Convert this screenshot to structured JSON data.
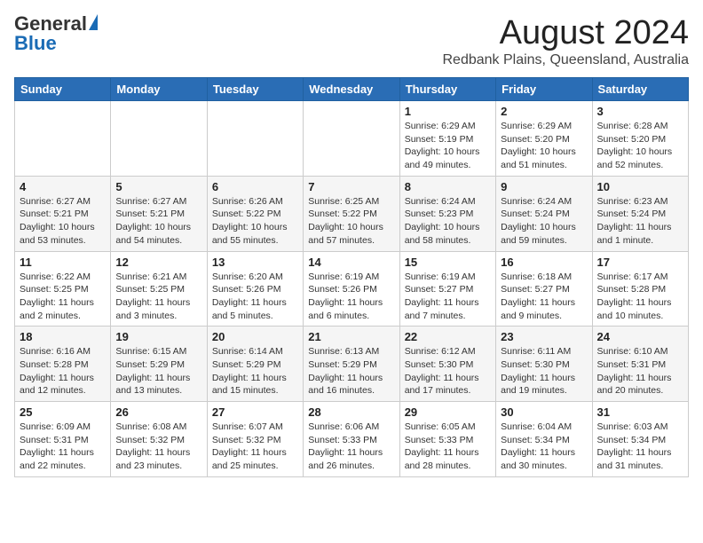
{
  "header": {
    "logo_general": "General",
    "logo_blue": "Blue",
    "month_title": "August 2024",
    "location": "Redbank Plains, Queensland, Australia"
  },
  "weekdays": [
    "Sunday",
    "Monday",
    "Tuesday",
    "Wednesday",
    "Thursday",
    "Friday",
    "Saturday"
  ],
  "weeks": [
    [
      {
        "day": "",
        "info": ""
      },
      {
        "day": "",
        "info": ""
      },
      {
        "day": "",
        "info": ""
      },
      {
        "day": "",
        "info": ""
      },
      {
        "day": "1",
        "info": "Sunrise: 6:29 AM\nSunset: 5:19 PM\nDaylight: 10 hours\nand 49 minutes."
      },
      {
        "day": "2",
        "info": "Sunrise: 6:29 AM\nSunset: 5:20 PM\nDaylight: 10 hours\nand 51 minutes."
      },
      {
        "day": "3",
        "info": "Sunrise: 6:28 AM\nSunset: 5:20 PM\nDaylight: 10 hours\nand 52 minutes."
      }
    ],
    [
      {
        "day": "4",
        "info": "Sunrise: 6:27 AM\nSunset: 5:21 PM\nDaylight: 10 hours\nand 53 minutes."
      },
      {
        "day": "5",
        "info": "Sunrise: 6:27 AM\nSunset: 5:21 PM\nDaylight: 10 hours\nand 54 minutes."
      },
      {
        "day": "6",
        "info": "Sunrise: 6:26 AM\nSunset: 5:22 PM\nDaylight: 10 hours\nand 55 minutes."
      },
      {
        "day": "7",
        "info": "Sunrise: 6:25 AM\nSunset: 5:22 PM\nDaylight: 10 hours\nand 57 minutes."
      },
      {
        "day": "8",
        "info": "Sunrise: 6:24 AM\nSunset: 5:23 PM\nDaylight: 10 hours\nand 58 minutes."
      },
      {
        "day": "9",
        "info": "Sunrise: 6:24 AM\nSunset: 5:24 PM\nDaylight: 10 hours\nand 59 minutes."
      },
      {
        "day": "10",
        "info": "Sunrise: 6:23 AM\nSunset: 5:24 PM\nDaylight: 11 hours\nand 1 minute."
      }
    ],
    [
      {
        "day": "11",
        "info": "Sunrise: 6:22 AM\nSunset: 5:25 PM\nDaylight: 11 hours\nand 2 minutes."
      },
      {
        "day": "12",
        "info": "Sunrise: 6:21 AM\nSunset: 5:25 PM\nDaylight: 11 hours\nand 3 minutes."
      },
      {
        "day": "13",
        "info": "Sunrise: 6:20 AM\nSunset: 5:26 PM\nDaylight: 11 hours\nand 5 minutes."
      },
      {
        "day": "14",
        "info": "Sunrise: 6:19 AM\nSunset: 5:26 PM\nDaylight: 11 hours\nand 6 minutes."
      },
      {
        "day": "15",
        "info": "Sunrise: 6:19 AM\nSunset: 5:27 PM\nDaylight: 11 hours\nand 7 minutes."
      },
      {
        "day": "16",
        "info": "Sunrise: 6:18 AM\nSunset: 5:27 PM\nDaylight: 11 hours\nand 9 minutes."
      },
      {
        "day": "17",
        "info": "Sunrise: 6:17 AM\nSunset: 5:28 PM\nDaylight: 11 hours\nand 10 minutes."
      }
    ],
    [
      {
        "day": "18",
        "info": "Sunrise: 6:16 AM\nSunset: 5:28 PM\nDaylight: 11 hours\nand 12 minutes."
      },
      {
        "day": "19",
        "info": "Sunrise: 6:15 AM\nSunset: 5:29 PM\nDaylight: 11 hours\nand 13 minutes."
      },
      {
        "day": "20",
        "info": "Sunrise: 6:14 AM\nSunset: 5:29 PM\nDaylight: 11 hours\nand 15 minutes."
      },
      {
        "day": "21",
        "info": "Sunrise: 6:13 AM\nSunset: 5:29 PM\nDaylight: 11 hours\nand 16 minutes."
      },
      {
        "day": "22",
        "info": "Sunrise: 6:12 AM\nSunset: 5:30 PM\nDaylight: 11 hours\nand 17 minutes."
      },
      {
        "day": "23",
        "info": "Sunrise: 6:11 AM\nSunset: 5:30 PM\nDaylight: 11 hours\nand 19 minutes."
      },
      {
        "day": "24",
        "info": "Sunrise: 6:10 AM\nSunset: 5:31 PM\nDaylight: 11 hours\nand 20 minutes."
      }
    ],
    [
      {
        "day": "25",
        "info": "Sunrise: 6:09 AM\nSunset: 5:31 PM\nDaylight: 11 hours\nand 22 minutes."
      },
      {
        "day": "26",
        "info": "Sunrise: 6:08 AM\nSunset: 5:32 PM\nDaylight: 11 hours\nand 23 minutes."
      },
      {
        "day": "27",
        "info": "Sunrise: 6:07 AM\nSunset: 5:32 PM\nDaylight: 11 hours\nand 25 minutes."
      },
      {
        "day": "28",
        "info": "Sunrise: 6:06 AM\nSunset: 5:33 PM\nDaylight: 11 hours\nand 26 minutes."
      },
      {
        "day": "29",
        "info": "Sunrise: 6:05 AM\nSunset: 5:33 PM\nDaylight: 11 hours\nand 28 minutes."
      },
      {
        "day": "30",
        "info": "Sunrise: 6:04 AM\nSunset: 5:34 PM\nDaylight: 11 hours\nand 30 minutes."
      },
      {
        "day": "31",
        "info": "Sunrise: 6:03 AM\nSunset: 5:34 PM\nDaylight: 11 hours\nand 31 minutes."
      }
    ]
  ]
}
